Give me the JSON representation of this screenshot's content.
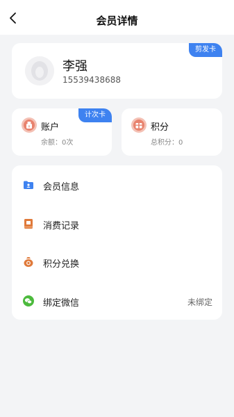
{
  "header": {
    "title": "会员详情",
    "back_icon": "chevron-left-icon"
  },
  "profile": {
    "name": "李强",
    "phone": "15539438688",
    "card_type_badge": "剪发卡",
    "avatar_icon": "default-avatar-icon"
  },
  "account": {
    "title": "账户",
    "subtitle": "余额：0次",
    "badge": "计次卡",
    "icon": "money-bag-icon",
    "icon_color": "#e8826d"
  },
  "points": {
    "title": "积分",
    "subtitle": "总积分：0",
    "icon": "gift-box-icon",
    "icon_color": "#e8826d"
  },
  "menu": {
    "items": [
      {
        "label": "会员信息",
        "icon": "folder-user-icon",
        "icon_color": "#3e82f0",
        "value": ""
      },
      {
        "label": "消费记录",
        "icon": "receipt-book-icon",
        "icon_color": "#e07a3b",
        "value": ""
      },
      {
        "label": "积分兑换",
        "icon": "exchange-bag-icon",
        "icon_color": "#e07a3b",
        "value": ""
      },
      {
        "label": "绑定微信",
        "icon": "wechat-icon",
        "icon_color": "#4cba3d",
        "value": "未绑定"
      }
    ]
  },
  "colors": {
    "accent": "#3e82f0",
    "background": "#f3f4f6",
    "card": "#ffffff"
  }
}
